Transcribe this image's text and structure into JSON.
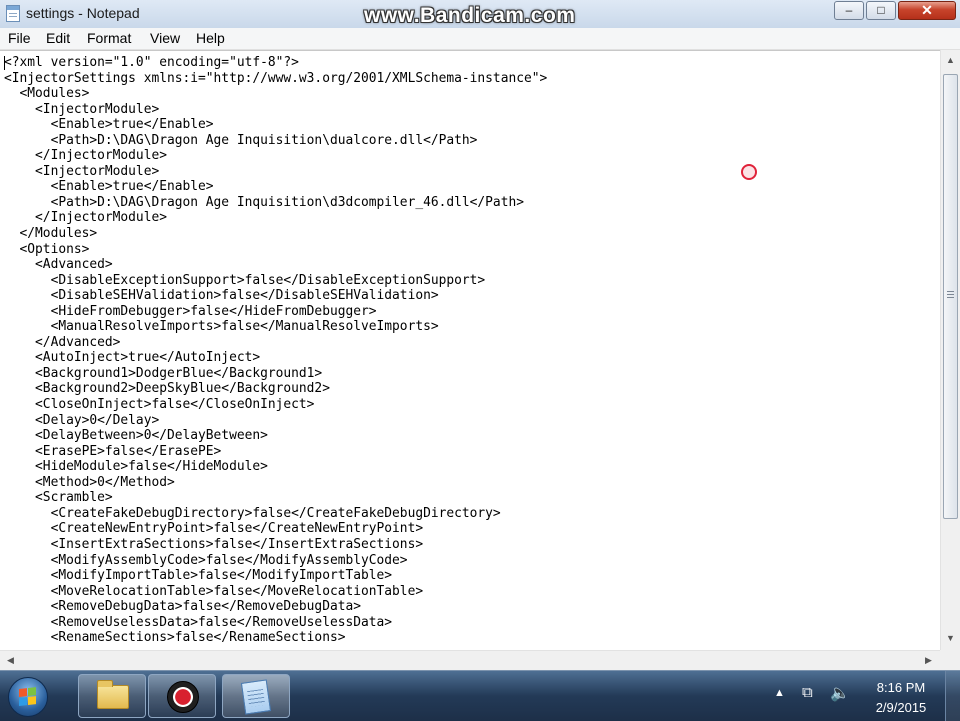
{
  "window": {
    "title": "settings - Notepad",
    "watermark": "www.Bandicam.com",
    "minimize_glyph": "–",
    "maximize_glyph": "□",
    "close_glyph": "✕"
  },
  "menu": [
    "File",
    "Edit",
    "Format",
    "View",
    "Help"
  ],
  "document": {
    "lines": [
      "<?xml version=\"1.0\" encoding=\"utf-8\"?>",
      "<InjectorSettings xmlns:i=\"http://www.w3.org/2001/XMLSchema-instance\">",
      "  <Modules>",
      "    <InjectorModule>",
      "      <Enable>true</Enable>",
      "      <Path>D:\\DAG\\Dragon Age Inquisition\\dualcore.dll</Path>",
      "    </InjectorModule>",
      "    <InjectorModule>",
      "      <Enable>true</Enable>",
      "      <Path>D:\\DAG\\Dragon Age Inquisition\\d3dcompiler_46.dll</Path>",
      "    </InjectorModule>",
      "  </Modules>",
      "  <Options>",
      "    <Advanced>",
      "      <DisableExceptionSupport>false</DisableExceptionSupport>",
      "      <DisableSEHValidation>false</DisableSEHValidation>",
      "      <HideFromDebugger>false</HideFromDebugger>",
      "      <ManualResolveImports>false</ManualResolveImports>",
      "    </Advanced>",
      "    <AutoInject>true</AutoInject>",
      "    <Background1>DodgerBlue</Background1>",
      "    <Background2>DeepSkyBlue</Background2>",
      "    <CloseOnInject>false</CloseOnInject>",
      "    <Delay>0</Delay>",
      "    <DelayBetween>0</DelayBetween>",
      "    <ErasePE>false</ErasePE>",
      "    <HideModule>false</HideModule>",
      "    <Method>0</Method>",
      "    <Scramble>",
      "      <CreateFakeDebugDirectory>false</CreateFakeDebugDirectory>",
      "      <CreateNewEntryPoint>false</CreateNewEntryPoint>",
      "      <InsertExtraSections>false</InsertExtraSections>",
      "      <ModifyAssemblyCode>false</ModifyAssemblyCode>",
      "      <ModifyImportTable>false</ModifyImportTable>",
      "      <MoveRelocationTable>false</MoveRelocationTable>",
      "      <RemoveDebugData>false</RemoveDebugData>",
      "      <RemoveUselessData>false</RemoveUselessData>",
      "      <RenameSections>false</RenameSections>"
    ]
  },
  "scrollbars": {
    "up_arrow": "▲",
    "down_arrow": "▼",
    "left_arrow": "◀",
    "right_arrow": "▶"
  },
  "taskbar": {
    "buttons": [
      {
        "name": "Windows Explorer",
        "icon": "folder-icon"
      },
      {
        "name": "Bandicam",
        "icon": "bandicam-icon"
      },
      {
        "name": "Notepad",
        "icon": "notepad-icon"
      }
    ],
    "tray": {
      "show_hidden_glyph": "▲",
      "network_glyph": "⧉",
      "volume_glyph": "🔈"
    },
    "clock": {
      "time": "8:16 PM",
      "date": "2/9/2015"
    }
  },
  "colors": {
    "recording_indicator": "#e0223a",
    "taskbar": "#233a57",
    "close_button": "#c7442c"
  }
}
